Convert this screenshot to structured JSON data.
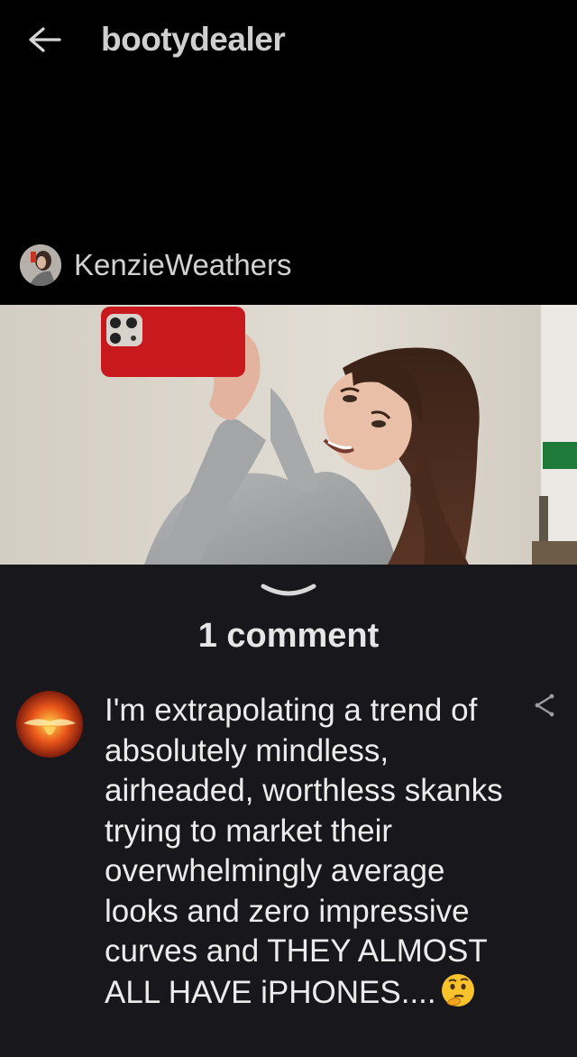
{
  "header": {
    "back_icon": "arrow-left-icon",
    "title": "bootydealer"
  },
  "post": {
    "author": "KenzieWeathers",
    "author_avatar": "avatar-photo",
    "image": "mirror-selfie-photo"
  },
  "comments": {
    "expand_icon": "chevron-down-icon",
    "count_label": "1 comment",
    "items": [
      {
        "avatar": "fire-avatar",
        "text": "I'm extrapolating a trend of absolutely mindless, airheaded, worthless skanks trying to market their overwhelmingly average looks and zero impressive curves and THEY ALMOST ALL HAVE iPHONES....",
        "emoji": "thinking-face-emoji",
        "share_icon": "share-icon"
      }
    ]
  },
  "colors": {
    "top_background": "#000000",
    "bottom_background": "#17171c",
    "text_primary": "#ececec",
    "phone_red": "#c81a1e"
  }
}
